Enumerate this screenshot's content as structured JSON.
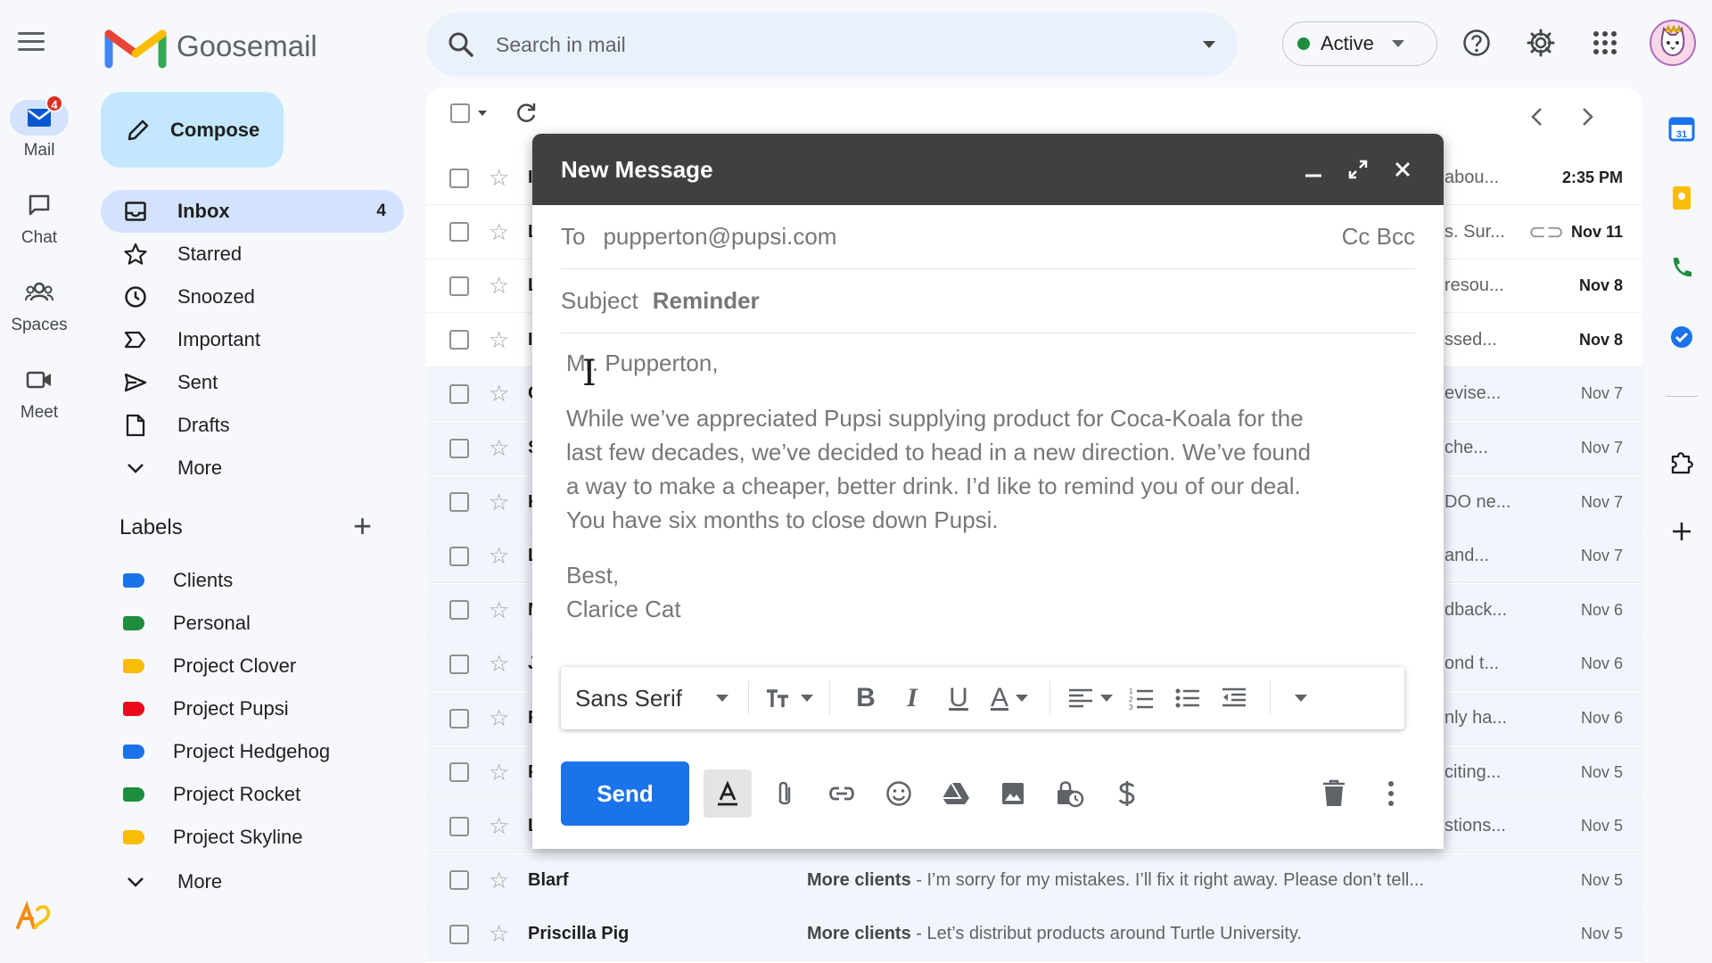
{
  "app": {
    "name": "Goosemail"
  },
  "rail": [
    {
      "label": "Mail",
      "badge": "4"
    },
    {
      "label": "Chat"
    },
    {
      "label": "Spaces"
    },
    {
      "label": "Meet"
    }
  ],
  "search": {
    "placeholder": "Search in mail"
  },
  "status": {
    "label": "Active",
    "color": "#1e8e3e"
  },
  "nav": {
    "compose": "Compose",
    "items": [
      {
        "label": "Inbox",
        "count": "4"
      },
      {
        "label": "Starred"
      },
      {
        "label": "Snoozed"
      },
      {
        "label": "Important"
      },
      {
        "label": "Sent"
      },
      {
        "label": "Drafts"
      },
      {
        "label": "More"
      }
    ]
  },
  "labels": {
    "title": "Labels",
    "items": [
      {
        "label": "Clients",
        "color": "#1a73e8"
      },
      {
        "label": "Personal",
        "color": "#1e8e3e"
      },
      {
        "label": "Project Clover",
        "color": "#fbbc04"
      },
      {
        "label": "Project Pupsi",
        "color": "#ea0a1a"
      },
      {
        "label": "Project Hedgehog",
        "color": "#1a73e8"
      },
      {
        "label": "Project Rocket",
        "color": "#1e8e3e"
      },
      {
        "label": "Project Skyline",
        "color": "#fbbc04"
      }
    ],
    "more": "More"
  },
  "mail": {
    "rows": [
      {
        "sender": "I",
        "snippet": "abou...",
        "date": "2:35 PM",
        "unread": true
      },
      {
        "sender": "L",
        "snippet": "s. Sur...",
        "date": "Nov 11",
        "unread": true,
        "attachment": true
      },
      {
        "sender": "L",
        "snippet": "resou...",
        "date": "Nov 8",
        "unread": true
      },
      {
        "sender": "I",
        "snippet": "ssed...",
        "date": "Nov 8",
        "unread": true
      },
      {
        "sender": "C",
        "snippet": "evise...",
        "date": "Nov 7"
      },
      {
        "sender": "S",
        "snippet": "che...",
        "date": "Nov 7"
      },
      {
        "sender": "K",
        "snippet": "DO ne...",
        "date": "Nov 7"
      },
      {
        "sender": "L",
        "snippet": "and...",
        "date": "Nov 7"
      },
      {
        "sender": "M",
        "snippet": "dback...",
        "date": "Nov 6"
      },
      {
        "sender": "J",
        "snippet": "ond t...",
        "date": "Nov 6"
      },
      {
        "sender": "F",
        "snippet": "nly ha...",
        "date": "Nov 6"
      },
      {
        "sender": "F",
        "snippet": "citing...",
        "date": "Nov 5"
      },
      {
        "sender": "L",
        "snippet": "stions...",
        "date": "Nov 5"
      }
    ],
    "full_rows": [
      {
        "sender": "Blarf",
        "subject": "More clients",
        "preview": " - I’m sorry for my mistakes. I’ll fix it right away. Please don’t tell...",
        "date": "Nov 5"
      },
      {
        "sender": "Priscilla Pig",
        "subject": "More clients",
        "preview": " - Let’s distribut products around Turtle University.",
        "date": "Nov 5"
      }
    ]
  },
  "compose_window": {
    "title": "New Message",
    "to_label": "To",
    "to_value": "pupperton@pupsi.com",
    "cc_bcc": "Cc Bcc",
    "subject_label": "Subject",
    "subject_value": "Reminder",
    "body": {
      "greeting": "Mr. Pupperton,",
      "line1": "While we’ve appreciated Pupsi supplying product for Coca-Koala for the",
      "line2": "last few decades, we’ve decided to head in a new direction. We’ve found",
      "line3": "a way to make a cheaper, better drink. I’d like to remind you of our deal.",
      "line4": "You have six months to close down Pupsi.",
      "signoff": "Best,",
      "signature": "Clarice Cat"
    },
    "font": "Sans Serif",
    "send_label": "Send"
  }
}
